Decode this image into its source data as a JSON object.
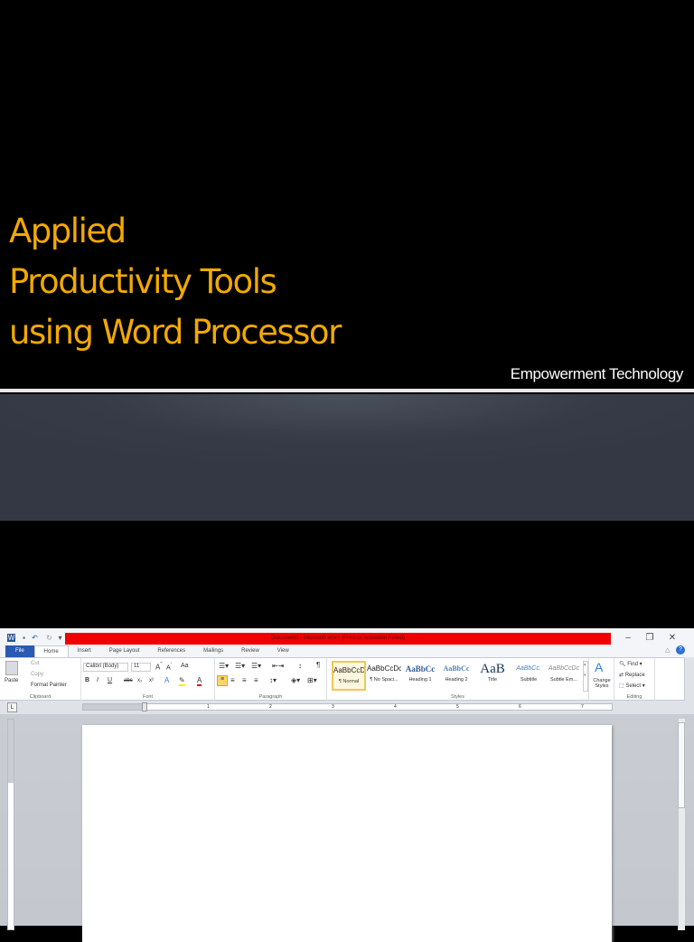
{
  "slide": {
    "title_lines": [
      "Applied",
      "Productivity Tools",
      "using Word Processor"
    ],
    "subtitle": "Empowerment Technology",
    "colors": {
      "title": "#f2a900",
      "background": "#000000",
      "band": "#363b47"
    }
  },
  "word": {
    "window_title": "Document1 - Microsoft Word (Product Activation Failed)",
    "title_bar_color": "#f00000",
    "tabs": [
      "File",
      "Home",
      "Insert",
      "Page Layout",
      "References",
      "Mailings",
      "Review",
      "View"
    ],
    "active_tab": "Home",
    "clipboard": {
      "paste": "Paste",
      "cut": "Cut",
      "copy": "Copy",
      "format_painter": "Format Painter",
      "label": "Clipboard"
    },
    "font": {
      "name": "Calibri (Body)",
      "size": "11",
      "label": "Font",
      "case": "Aa",
      "bold": "B",
      "italic": "I",
      "underline": "U",
      "strike": "abc",
      "sub": "x₂",
      "sup": "x²"
    },
    "paragraph": {
      "label": "Paragraph",
      "pilcrow": "¶"
    },
    "styles": {
      "label": "Styles",
      "items": [
        {
          "preview": "AaBbCcDc",
          "name": "¶ Normal"
        },
        {
          "preview": "AaBbCcDc",
          "name": "¶ No Spaci..."
        },
        {
          "preview": "AaBbCc",
          "name": "Heading 1"
        },
        {
          "preview": "AaBbCc",
          "name": "Heading 2"
        },
        {
          "preview": "AaB",
          "name": "Title"
        },
        {
          "preview": "AaBbCc.",
          "name": "Subtitle"
        },
        {
          "preview": "AaBbCcDc",
          "name": "Subtle Em..."
        }
      ],
      "change_styles": "Change Styles"
    },
    "editing": {
      "label": "Editing",
      "find": "Find",
      "replace": "Replace",
      "select": "Select"
    },
    "ruler_numbers": [
      "1",
      "1",
      "2",
      "3",
      "4",
      "5",
      "6",
      "7"
    ]
  }
}
